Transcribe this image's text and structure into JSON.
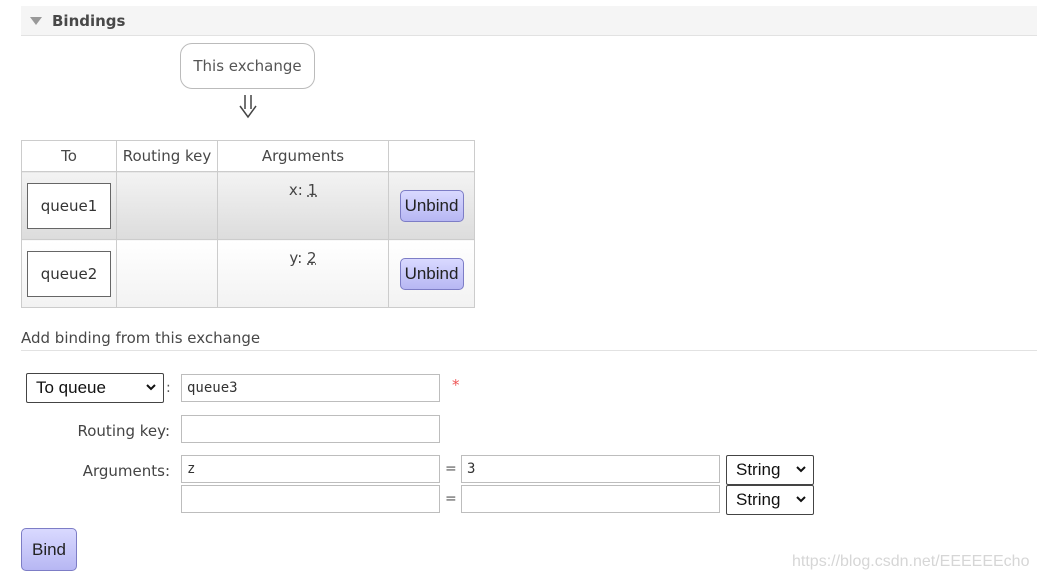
{
  "section": {
    "title": "Bindings"
  },
  "exchange_box": {
    "label": "This exchange"
  },
  "arrow_icon": "double-down-arrow",
  "table": {
    "headers": [
      "To",
      "Routing key",
      "Arguments",
      ""
    ],
    "rows": [
      {
        "to": "queue1",
        "routing_key": "",
        "arg_key": "x:",
        "arg_value": "1",
        "action": "Unbind"
      },
      {
        "to": "queue2",
        "routing_key": "",
        "arg_key": "y:",
        "arg_value": "2",
        "action": "Unbind"
      }
    ]
  },
  "add_binding": {
    "title": "Add binding from this exchange",
    "destination_type": "To queue",
    "destination_sep": ":",
    "destination_value": "queue3",
    "required_mark": "*",
    "routing_key_label": "Routing key:",
    "routing_key_value": "",
    "arguments_label": "Arguments:",
    "arguments": [
      {
        "key": "z",
        "eq": "=",
        "value": "3",
        "type": "String"
      },
      {
        "key": "",
        "eq": "=",
        "value": "",
        "type": "String"
      }
    ],
    "bind_label": "Bind"
  },
  "watermark": "https://blog.csdn.net/EEEEEEcho",
  "colors": {
    "button": "#c8c8fa",
    "button_border": "#7d7dc6",
    "required": "#ee5555"
  }
}
